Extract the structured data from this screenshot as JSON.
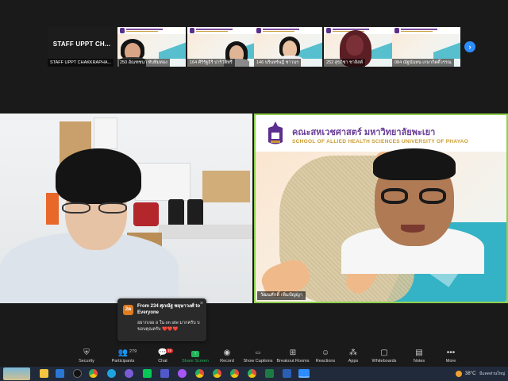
{
  "strip": {
    "participants": [
      {
        "label": "STAFF UPPT CHAKKRAPHA...",
        "display": "STAFF UPPT CH..."
      },
      {
        "label": "250 อัณฑชนา ทับทิมทอง"
      },
      {
        "label": "164 ศิริรัฐธิรี ปาริวัติทรี"
      },
      {
        "label": "146 นรินทร์ษฎี ชาวนร"
      },
      {
        "label": "252 สุรภิชา ชาลิสต์"
      },
      {
        "label": "084 ณัฐนันทน เกษากิตติ์วรรณ"
      }
    ],
    "next_icon": "chevron-right-icon"
  },
  "videos": {
    "left": {
      "name": ""
    },
    "right": {
      "name": "วัฒนศักดิ์ เพิ่มปัญญา",
      "slide_title_th": "คณะสหเวชศาสตร์ มหาวิทยาลัยพะเยา",
      "slide_title_en": "SCHOOL OF ALLIED HEALTH SCIENCES UNIVERSITY OF PHAYAO",
      "accent": "#8fd14f"
    }
  },
  "chat_popup": {
    "avatar": "2ต",
    "from": "From 234 ศุภณัฐ พฤษาวงศ์ to Everyone",
    "message": "อยากเจอ อ ใน on site มากครับ บ ขอบคุณครับ ❤️❤️❤️",
    "avatar_color": "#e07b20"
  },
  "toolbar": {
    "participants_count": "279",
    "chat_badge": "15",
    "buttons": [
      {
        "label": "Security",
        "icon": "shield-icon"
      },
      {
        "label": "Participants",
        "icon": "participants-icon"
      },
      {
        "label": "Chat",
        "icon": "chat-icon"
      },
      {
        "label": "Share Screen",
        "icon": "share-screen-icon"
      },
      {
        "label": "Record",
        "icon": "record-icon"
      },
      {
        "label": "Show Captions",
        "icon": "captions-icon"
      },
      {
        "label": "Breakout Rooms",
        "icon": "breakout-rooms-icon"
      },
      {
        "label": "Reactions",
        "icon": "reactions-icon"
      },
      {
        "label": "Apps",
        "icon": "apps-icon"
      },
      {
        "label": "Whiteboards",
        "icon": "whiteboard-icon"
      },
      {
        "label": "Notes",
        "icon": "notes-icon"
      },
      {
        "label": "More",
        "icon": "more-icon"
      }
    ],
    "share_color": "#23b35b"
  },
  "taskbar": {
    "temperature": "38°C",
    "weather_text": "มีแดดส่วนใหญ่",
    "apps": [
      "explorer-icon",
      "mail-icon",
      "media-icon",
      "chrome-icon",
      "edge-icon",
      "firefox-icon",
      "line-icon",
      "teams-icon",
      "messenger-icon",
      "chrome-icon",
      "chrome-icon",
      "chrome-icon",
      "chrome-icon",
      "excel-icon",
      "word-icon",
      "zoom-icon"
    ]
  }
}
